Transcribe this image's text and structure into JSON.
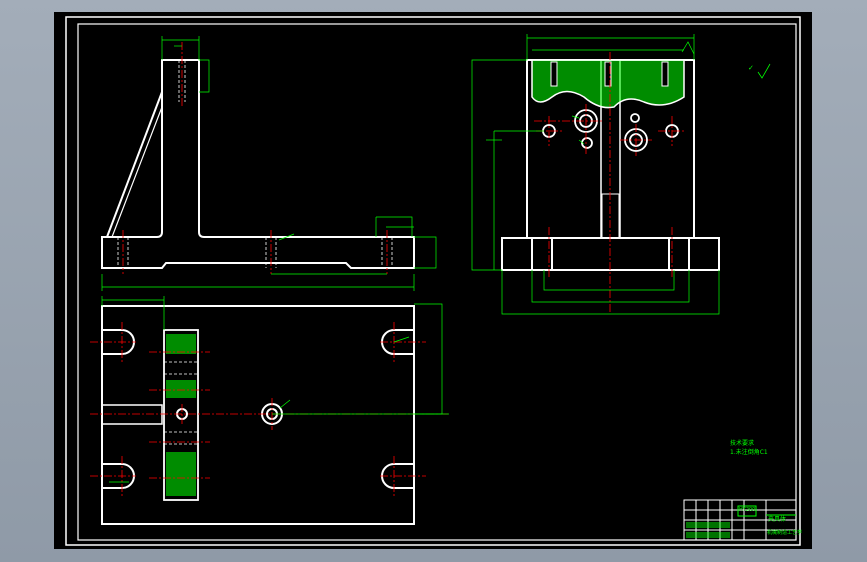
{
  "drawing": {
    "colors": {
      "background": "#000000",
      "outline": "#ffffff",
      "dimension": "#00ff00",
      "centerline": "#ff0000",
      "hatch": "#00ff00",
      "hidden": "#ffffff"
    },
    "views": [
      "front-view",
      "side-view",
      "top-view"
    ]
  },
  "notes": {
    "roughness_symbol": "✓",
    "line1": "技术要求",
    "line2": "1.未注倒角C1"
  },
  "title_block": {
    "part_name": "夹具体",
    "box_label": "HT200",
    "drawing_no": "机械制造工艺学"
  }
}
